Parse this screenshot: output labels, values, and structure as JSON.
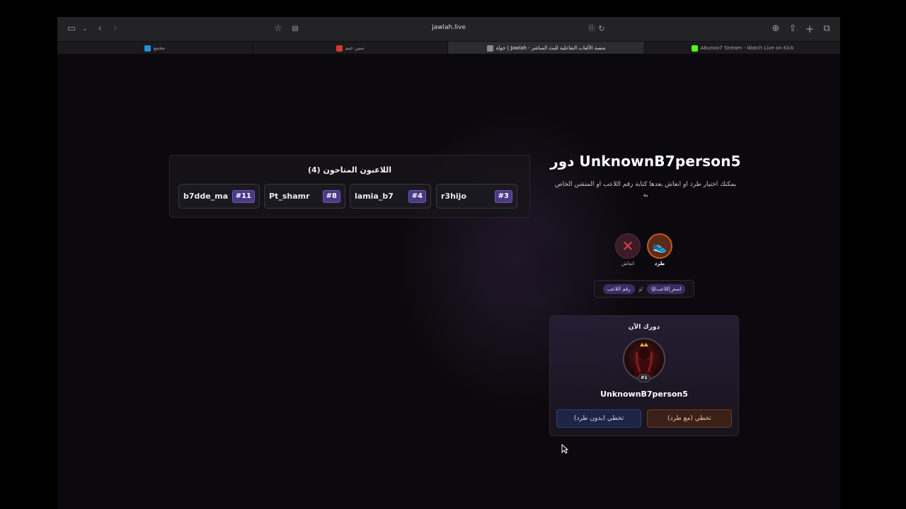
{
  "browser": {
    "url": "jawlah.live",
    "tabs": [
      {
        "label": "مجمع",
        "color": "#1f8fd6"
      },
      {
        "label": "سين جيم",
        "color": "#d43a2a"
      },
      {
        "label": "جولة | Jawlah - منصة الألعاب التفاعلية للبث المباشر",
        "color": "#8a8890"
      },
      {
        "label": "Abunoo7 Stream - Watch Live on Kick",
        "color": "#53fc18"
      }
    ]
  },
  "eliminated": {
    "title": "اللاعبون المتاحون (4)",
    "players": [
      {
        "name": "b7dde_ma",
        "number": "#11"
      },
      {
        "name": "Pt_shamr",
        "number": "#8"
      },
      {
        "name": "lamia_b7",
        "number": "#4"
      },
      {
        "name": "r3hijo",
        "number": "#3"
      }
    ]
  },
  "turn": {
    "title": "دور UnknownB7person5",
    "description": "يمكنك اختيار طرد او انعاش بعدها كتابة رقم اللاعب او المنشن الخاص به",
    "actions": {
      "revive_label": "انعاش",
      "kick_label": "طرد"
    },
    "hint": {
      "mention": "@اسم_اللاعب",
      "or": "او",
      "number": "رقم اللاعب"
    }
  },
  "current": {
    "title": "دورك الآن",
    "rank": "#1",
    "player": "UnknownB7person5",
    "skip_no_kick": "تخطي (بدون طرد)",
    "skip_with_kick": "تخطي (مع طرد)"
  },
  "colors": {
    "accent_purple": "#4a3a86",
    "kick_orange": "#c8582a",
    "revive_red": "#d63a4a"
  }
}
